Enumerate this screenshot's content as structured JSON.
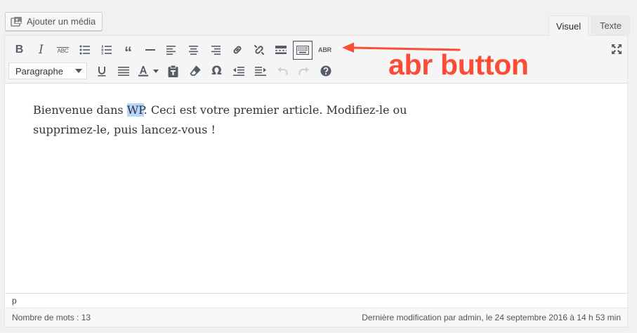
{
  "media_button": {
    "label": "Ajouter un média",
    "icon": "media-icon"
  },
  "tabs": [
    {
      "label": "Visuel",
      "active": true
    },
    {
      "label": "Texte",
      "active": false
    }
  ],
  "toolbar": {
    "row1": [
      {
        "name": "bold-button",
        "icon": "bold-icon"
      },
      {
        "name": "italic-button",
        "icon": "italic-icon"
      },
      {
        "name": "strikethrough-button",
        "icon": "strikethrough-icon",
        "text": "ABC"
      },
      {
        "name": "bulleted-list-button",
        "icon": "bulleted-list-icon"
      },
      {
        "name": "numbered-list-button",
        "icon": "numbered-list-icon"
      },
      {
        "name": "blockquote-button",
        "icon": "blockquote-icon"
      },
      {
        "name": "horizontal-line-button",
        "icon": "horizontal-line-icon"
      },
      {
        "name": "align-left-button",
        "icon": "align-left-icon"
      },
      {
        "name": "align-center-button",
        "icon": "align-center-icon"
      },
      {
        "name": "align-right-button",
        "icon": "align-right-icon"
      },
      {
        "name": "insert-link-button",
        "icon": "link-icon"
      },
      {
        "name": "remove-link-button",
        "icon": "unlink-icon"
      },
      {
        "name": "read-more-button",
        "icon": "read-more-icon"
      },
      {
        "name": "toolbar-toggle-button",
        "icon": "keyboard-icon",
        "pressed": true
      },
      {
        "name": "abbr-button",
        "icon": "abbr-icon",
        "text": "ABR"
      }
    ],
    "format_select": {
      "value": "Paragraphe"
    },
    "row2": [
      {
        "name": "underline-button",
        "icon": "underline-icon"
      },
      {
        "name": "justify-button",
        "icon": "justify-icon"
      },
      {
        "name": "text-color-button",
        "icon": "text-color-icon"
      },
      {
        "name": "paste-as-text-button",
        "icon": "paste-text-icon"
      },
      {
        "name": "clear-formatting-button",
        "icon": "eraser-icon"
      },
      {
        "name": "special-character-button",
        "icon": "omega-icon"
      },
      {
        "name": "outdent-button",
        "icon": "outdent-icon"
      },
      {
        "name": "indent-button",
        "icon": "indent-icon"
      },
      {
        "name": "undo-button",
        "icon": "undo-icon"
      },
      {
        "name": "redo-button",
        "icon": "redo-icon"
      },
      {
        "name": "help-button",
        "icon": "help-icon"
      }
    ],
    "fullscreen_icon": "fullscreen-icon"
  },
  "content": {
    "before": "Bienvenue dans ",
    "highlight": "WP",
    "after": ". Ceci est votre premier article. Modifiez-le ou supprimez-le, puis lancez-vous !"
  },
  "path": "p",
  "status": {
    "word_count": "Nombre de mots : 13",
    "last_modified": "Dernière modification par admin, le 24 septembre 2016 à 14 h 53 min"
  },
  "annotation": {
    "label": "abr button",
    "color": "#fb4c36"
  },
  "colors": {
    "highlight": "#b4d5fe",
    "icon": "#555d66",
    "editor_bg": "#ffffff",
    "toolbar_bg": "#f5f5f5"
  }
}
